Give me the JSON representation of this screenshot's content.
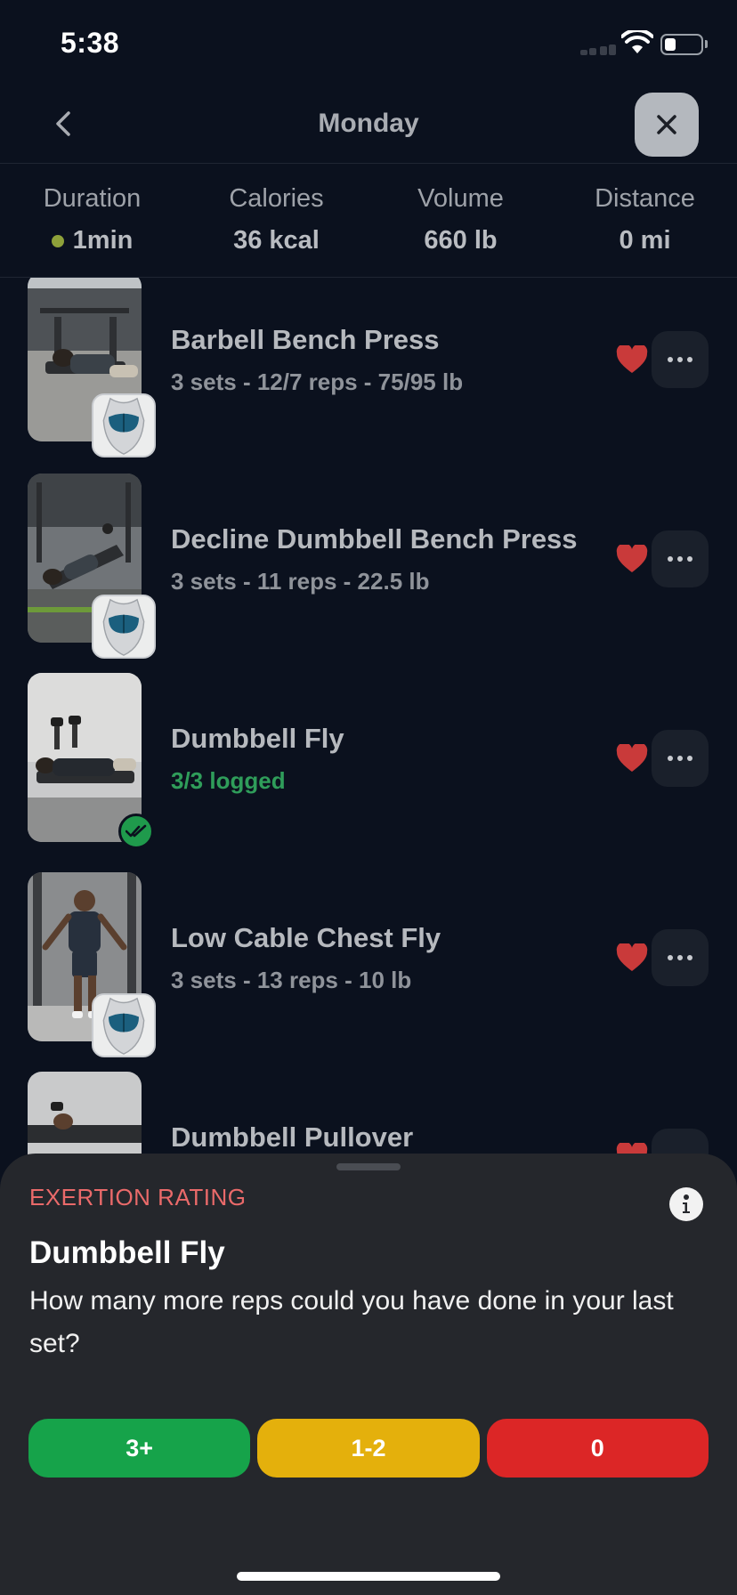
{
  "status_bar": {
    "time": "5:38"
  },
  "nav": {
    "title": "Monday"
  },
  "stats": [
    {
      "label": "Duration",
      "value": "1min",
      "live": true
    },
    {
      "label": "Calories",
      "value": "36 kcal"
    },
    {
      "label": "Volume",
      "value": "660 lb"
    },
    {
      "label": "Distance",
      "value": "0 mi"
    }
  ],
  "exercises": [
    {
      "name": "Barbell Bench Press",
      "detail": "3 sets - 12/7 reps - 75/95 lb",
      "favorite": true
    },
    {
      "name": "Decline Dumbbell Bench Press",
      "detail": "3 sets - 11 reps - 22.5 lb",
      "favorite": true
    },
    {
      "name": "Dumbbell Fly",
      "detail": "3/3 logged",
      "favorite": true,
      "logged": true
    },
    {
      "name": "Low Cable Chest Fly",
      "detail": "3 sets - 13 reps - 10 lb",
      "favorite": true
    },
    {
      "name": "Dumbbell Pullover",
      "detail": "",
      "favorite": true
    }
  ],
  "sheet": {
    "label": "EXERTION RATING",
    "title": "Dumbbell Fly",
    "question": "How many more reps could you have done in your last set?",
    "options": [
      {
        "label": "3+",
        "color": "#16a34a"
      },
      {
        "label": "1-2",
        "color": "#e4b00c"
      },
      {
        "label": "0",
        "color": "#dc2626"
      }
    ]
  },
  "colors": {
    "background": "#0b111e",
    "heart": "#c93a3a",
    "logged": "#2f9d5a",
    "exertion_label": "#ea6a6a"
  }
}
